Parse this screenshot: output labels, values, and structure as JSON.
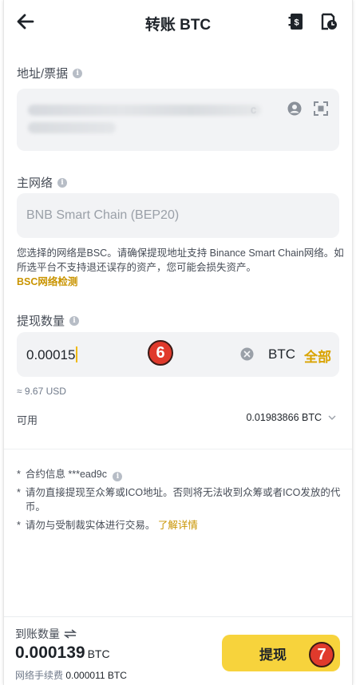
{
  "header": {
    "title": "转账 BTC"
  },
  "address": {
    "label": "地址/票据",
    "blurred_suffix": "c"
  },
  "network": {
    "label": "主网络",
    "value": "BNB Smart Chain (BEP20)"
  },
  "network_note": {
    "text": "您选择的网络是BSC。请确保提现地址支持 Binance Smart Chain网络。如所选平台不支持退还误存的资产，您可能会损失资产。",
    "link": "BSC网络检测"
  },
  "amount": {
    "label": "提现数量",
    "value": "0.00015",
    "unit": "BTC",
    "all": "全部",
    "approx": "≈ 9.67 USD"
  },
  "available": {
    "label": "可用",
    "value": "0.01983866 BTC"
  },
  "notes": [
    {
      "star": "*",
      "text": "合约信息 ***ead9c"
    },
    {
      "star": "*",
      "text": "请勿直接提现至众筹或ICO地址。否则将无法收到众筹或者ICO发放的代币。"
    },
    {
      "star": "*",
      "text": "请勿与受制裁实体进行交易。",
      "link": "了解详情"
    }
  ],
  "bottom": {
    "receive_label": "到账数量",
    "receive_value": "0.000139",
    "receive_unit": "BTC",
    "fee_label": "网络手续费",
    "fee_value": "0.000011 BTC",
    "withdraw_label": "提现"
  },
  "badges": {
    "six": "6",
    "seven": "7"
  },
  "colors": {
    "accent": "#f0b90b",
    "button": "#f7d33c",
    "badge": "#e03a2c",
    "field_bg": "#f2f3f5"
  }
}
